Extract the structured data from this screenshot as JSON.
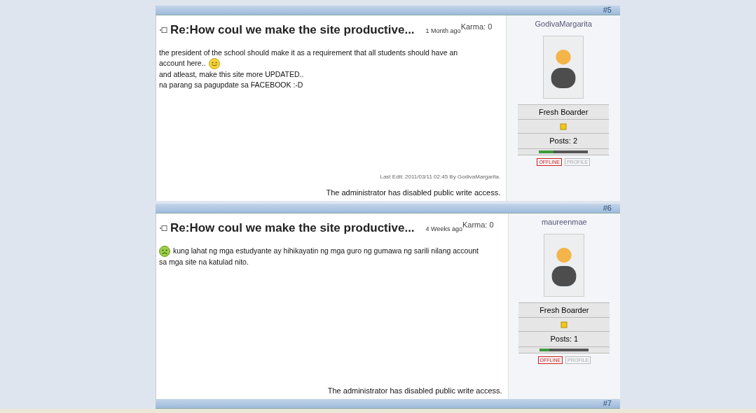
{
  "posts": [
    {
      "number": "#5",
      "title": "Re:How coul we make the site productive...",
      "time": "1 Month ago",
      "karma": "Karma: 0",
      "lines": [
        [
          {
            "kind": "text",
            "text": "the president of the school should make it as a requirement that all students should have an"
          }
        ],
        [
          {
            "kind": "text",
            "text": "account here.."
          },
          {
            "kind": "smile"
          }
        ],
        [
          {
            "kind": "text",
            "text": "and atleast, make this site more UPDATED.."
          }
        ],
        [
          {
            "kind": "text",
            "text": "na parang sa pagupdate sa FACEBOOK :-D"
          }
        ]
      ],
      "last_edit": "Last Edit: 2011/03/11 02:45 By GodivaMargarita.",
      "notice": "The administrator has disabled public write access.",
      "author": {
        "name": "GodivaMargarita",
        "rank": "Fresh Boarder",
        "posts": "Posts: 2",
        "level": 0.3,
        "status": "OFFLINE",
        "profile": "PROFILE"
      }
    },
    {
      "number": "#6",
      "title": "Re:How coul we make the site productive...",
      "time": "4 Weeks ago",
      "karma": "Karma: 0",
      "lines": [
        [
          {
            "kind": "frown"
          },
          {
            "kind": "text",
            "text": "kung lahat ng mga estudyante ay hihikayatin ng mga guro ng gumawa ng sarili nilang account"
          }
        ],
        [
          {
            "kind": "text",
            "text": "sa mga site na katulad nito."
          }
        ]
      ],
      "notice": "The administrator has disabled public write access.",
      "author": {
        "name": "maureenmae",
        "rank": "Fresh Boarder",
        "posts": "Posts: 1",
        "level": 0.2,
        "status": "OFFLINE",
        "profile": "PROFILE"
      }
    }
  ],
  "next_number": "#7"
}
